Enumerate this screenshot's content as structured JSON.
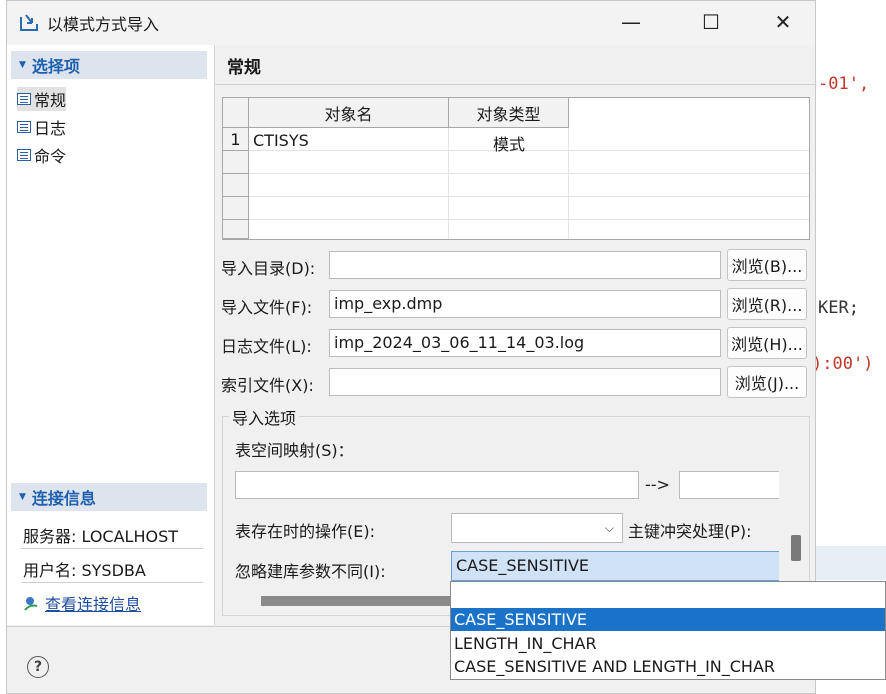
{
  "background_editor": {
    "snippets": [
      "-01',",
      "KER;",
      "):00')"
    ]
  },
  "window": {
    "title": "以模式方式导入",
    "minimize": "—",
    "maximize": "☐",
    "close": "✕"
  },
  "left_panel": {
    "options_header": "选择项",
    "items": [
      {
        "label": "常规"
      },
      {
        "label": "日志"
      },
      {
        "label": "命令"
      }
    ],
    "connection_header": "连接信息",
    "server": "服务器: LOCALHOST",
    "user": "用户名: SYSDBA",
    "view_connection": "查看连接信息"
  },
  "right_panel": {
    "title": "常规",
    "table": {
      "columns": [
        "对象名",
        "对象类型"
      ],
      "rows": [
        {
          "num": "1",
          "name": "CTISYS",
          "type": "模式"
        }
      ]
    },
    "import_dir": {
      "label": "导入目录(D):",
      "value": "",
      "button": "浏览(B)..."
    },
    "import_file": {
      "label": "导入文件(F):",
      "value": "imp_exp.dmp",
      "button": "浏览(R)..."
    },
    "log_file": {
      "label": "日志文件(L):",
      "value": "imp_2024_03_06_11_14_03.log",
      "button": "浏览(H)..."
    },
    "index_file": {
      "label": "索引文件(X):",
      "value": "",
      "button": "浏览(J)..."
    },
    "import_options": {
      "title": "导入选项",
      "tablespace_map_label": "表空间映射(S)：",
      "map_arrow": "-->",
      "table_exists_label": "表存在时的操作(E):",
      "pk_conflict_label": "主键冲突处理(P):",
      "ignore_param_label": "忽略建库参数不同(I):",
      "ignore_param_value": "CASE_SENSITIVE"
    }
  },
  "dropdown": {
    "options": [
      "",
      "CASE_SENSITIVE",
      "LENGTH_IN_CHAR",
      "CASE_SENSITIVE AND LENGTH_IN_CHAR"
    ],
    "selected_index": 1
  },
  "help_label": "?"
}
